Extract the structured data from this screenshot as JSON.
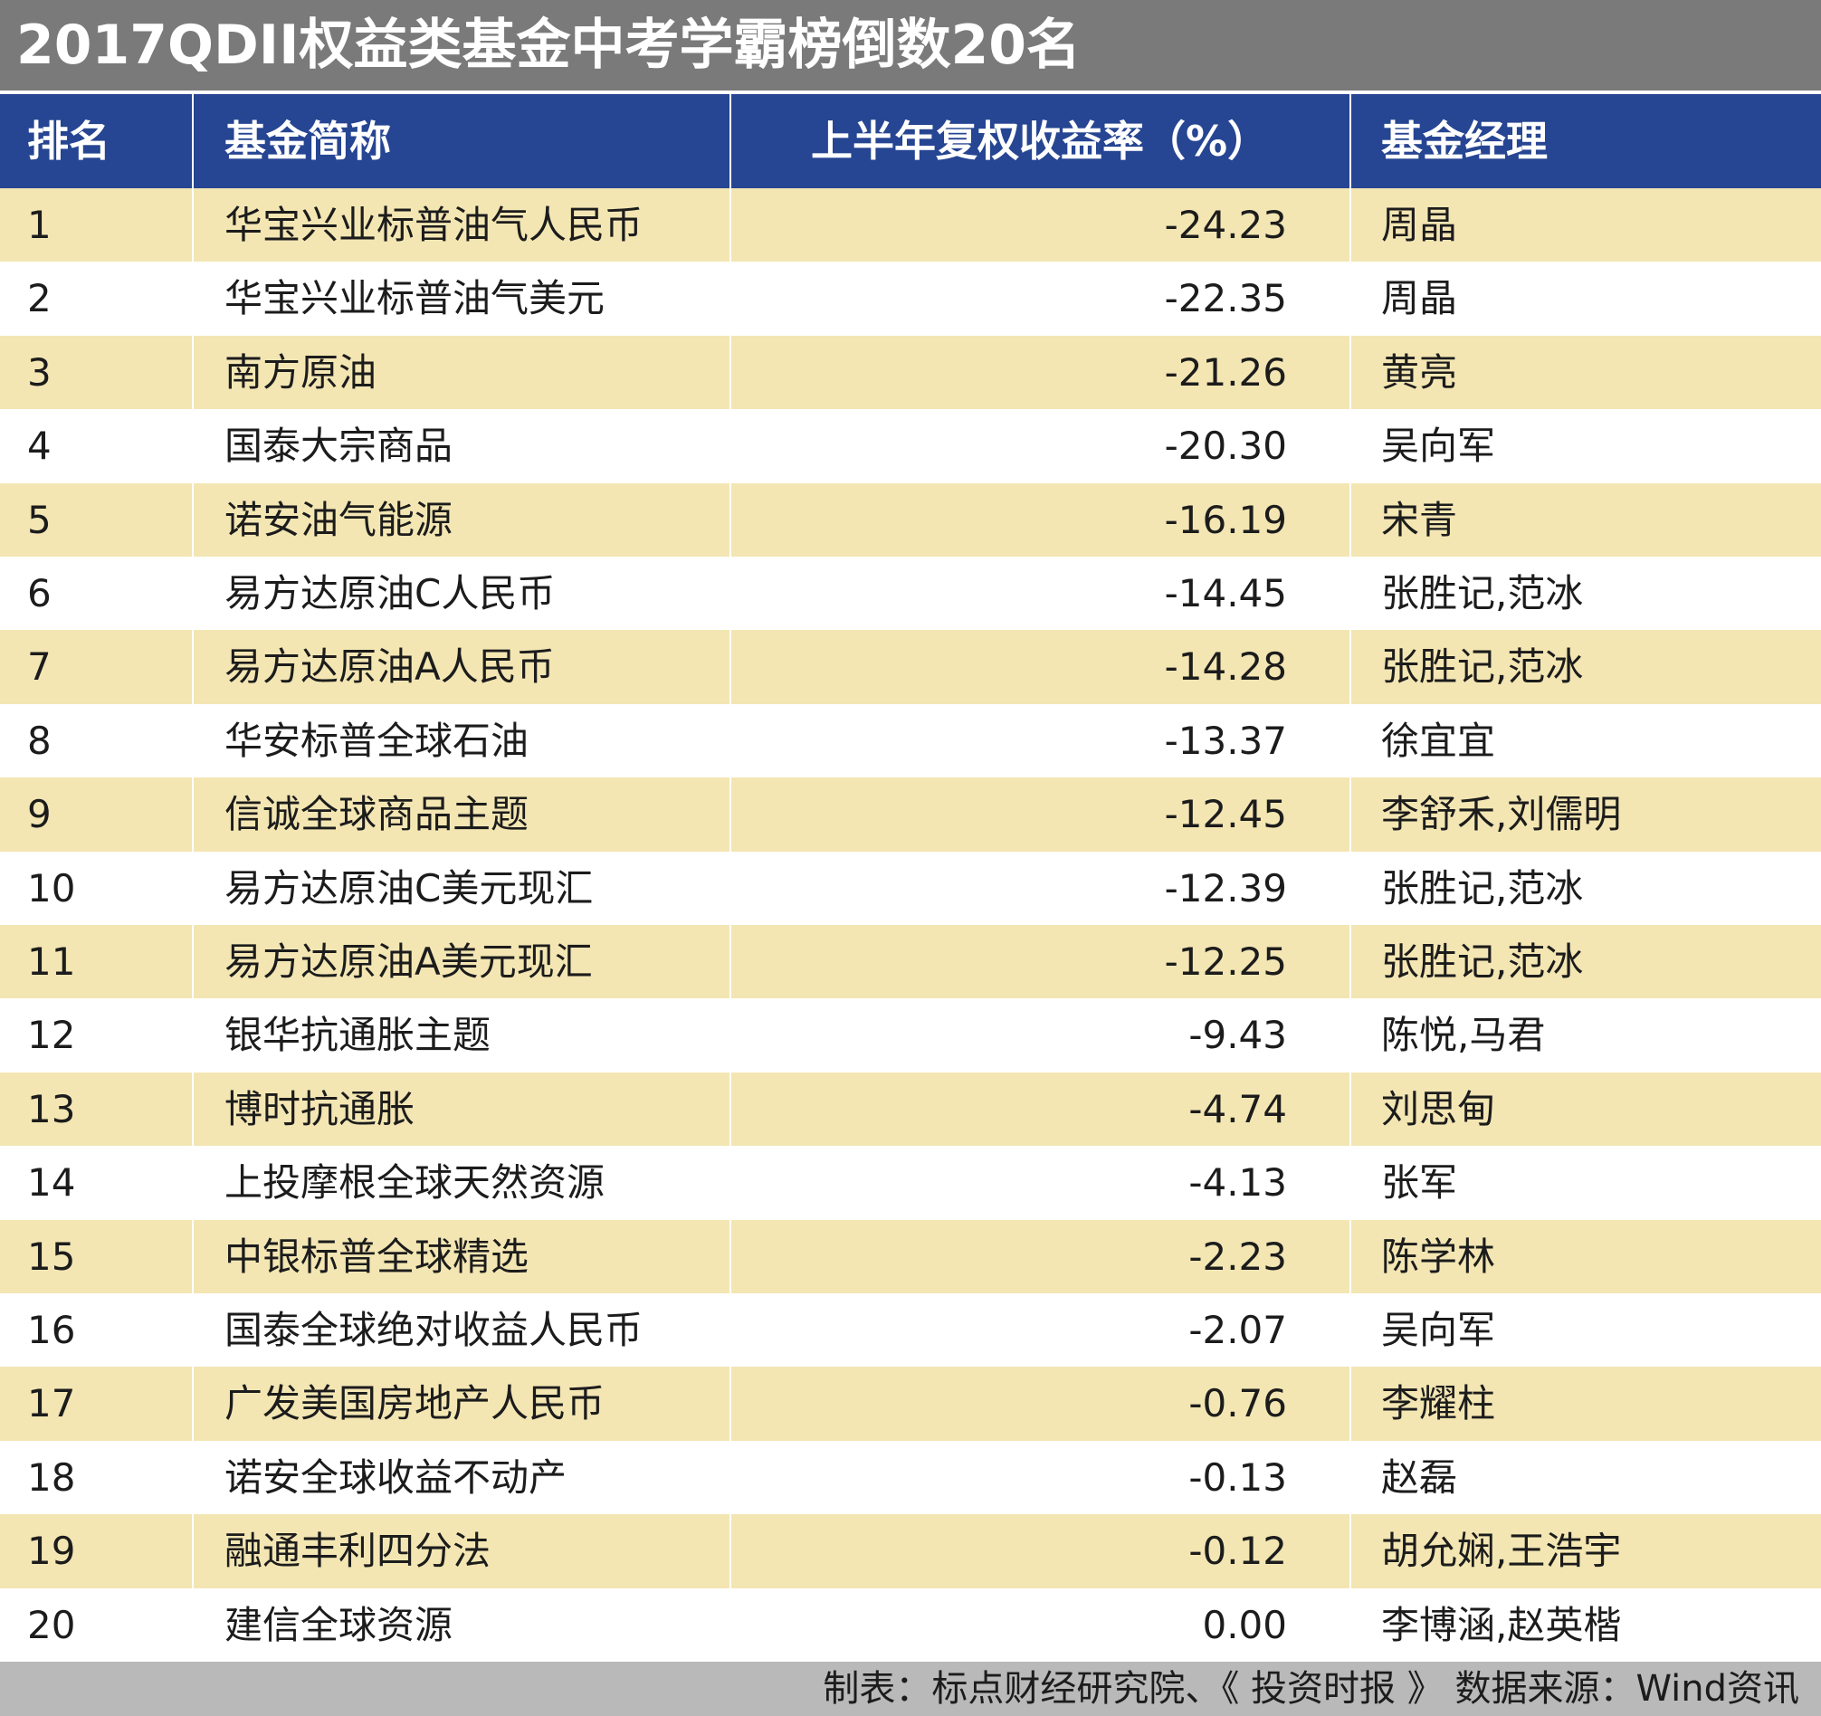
{
  "title": "2017QDII权益类基金中考学霸榜倒数20名",
  "colors": {
    "title_bg": "#7a7a7a",
    "header_bg": "#264592",
    "row_highlight": "#f3e6b3",
    "footer_bg": "#b9b9b9"
  },
  "table": {
    "headers": {
      "rank": "排名",
      "name": "基金简称",
      "return": "上半年复权收益率（%）",
      "manager": "基金经理"
    },
    "rows": [
      {
        "rank": "1",
        "name": "华宝兴业标普油气人民币",
        "return": "-24.23",
        "manager": "周晶"
      },
      {
        "rank": "2",
        "name": "华宝兴业标普油气美元",
        "return": "-22.35",
        "manager": "周晶"
      },
      {
        "rank": "3",
        "name": "南方原油",
        "return": "-21.26",
        "manager": "黄亮"
      },
      {
        "rank": "4",
        "name": "国泰大宗商品",
        "return": "-20.30",
        "manager": "吴向军"
      },
      {
        "rank": "5",
        "name": "诺安油气能源",
        "return": "-16.19",
        "manager": "宋青"
      },
      {
        "rank": "6",
        "name": "易方达原油C人民币",
        "return": "-14.45",
        "manager": "张胜记,范冰"
      },
      {
        "rank": "7",
        "name": "易方达原油A人民币",
        "return": "-14.28",
        "manager": "张胜记,范冰"
      },
      {
        "rank": "8",
        "name": "华安标普全球石油",
        "return": "-13.37",
        "manager": "徐宜宜"
      },
      {
        "rank": "9",
        "name": "信诚全球商品主题",
        "return": "-12.45",
        "manager": "李舒禾,刘儒明"
      },
      {
        "rank": "10",
        "name": "易方达原油C美元现汇",
        "return": "-12.39",
        "manager": "张胜记,范冰"
      },
      {
        "rank": "11",
        "name": "易方达原油A美元现汇",
        "return": "-12.25",
        "manager": "张胜记,范冰"
      },
      {
        "rank": "12",
        "name": "银华抗通胀主题",
        "return": "-9.43",
        "manager": "陈悦,马君"
      },
      {
        "rank": "13",
        "name": "博时抗通胀",
        "return": "-4.74",
        "manager": "刘思甸"
      },
      {
        "rank": "14",
        "name": "上投摩根全球天然资源",
        "return": "-4.13",
        "manager": "张军"
      },
      {
        "rank": "15",
        "name": "中银标普全球精选",
        "return": "-2.23",
        "manager": "陈学林"
      },
      {
        "rank": "16",
        "name": "国泰全球绝对收益人民币",
        "return": "-2.07",
        "manager": "吴向军"
      },
      {
        "rank": "17",
        "name": "广发美国房地产人民币",
        "return": "-0.76",
        "manager": "李耀柱"
      },
      {
        "rank": "18",
        "name": "诺安全球收益不动产",
        "return": "-0.13",
        "manager": "赵磊"
      },
      {
        "rank": "19",
        "name": "融通丰利四分法",
        "return": "-0.12",
        "manager": "胡允娴,王浩宇"
      },
      {
        "rank": "20",
        "name": "建信全球资源",
        "return": "0.00",
        "manager": "李博涵,赵英楷"
      }
    ]
  },
  "footer": "制表：标点财经研究院、《 投资时报 》 数据来源：Wind资讯"
}
